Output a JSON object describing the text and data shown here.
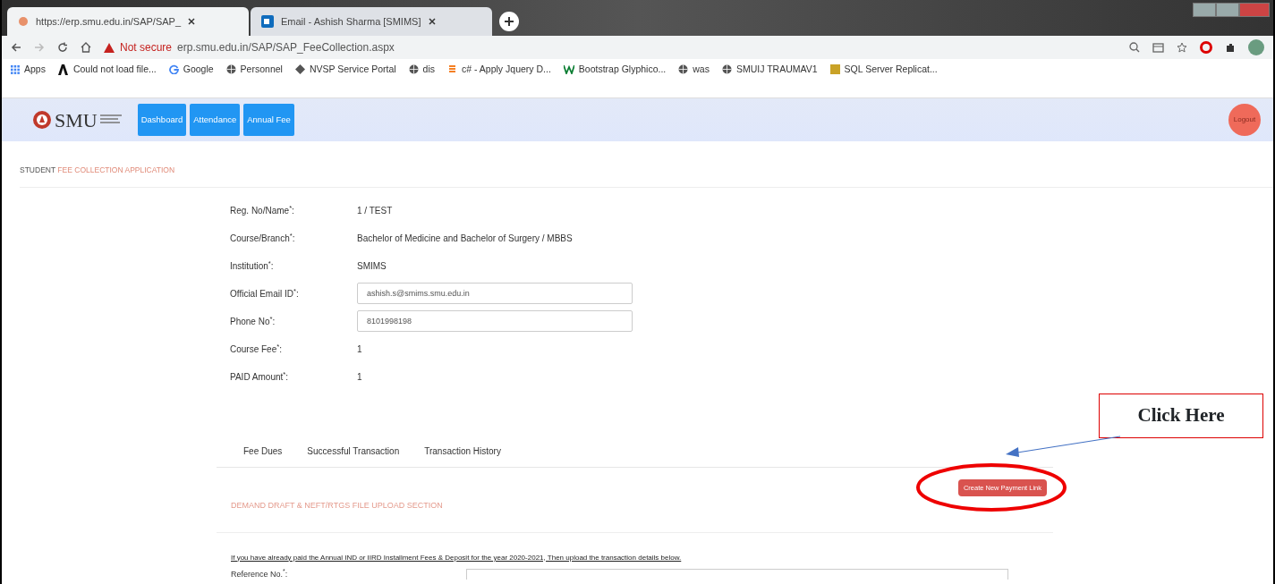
{
  "browser": {
    "tabs": [
      {
        "title": "https://erp.smu.edu.in/SAP/SAP_",
        "selected": true,
        "kind": "site"
      },
      {
        "title": "Email - Ashish Sharma [SMIMS]",
        "selected": false,
        "kind": "mail"
      }
    ],
    "address": {
      "security": "Not secure",
      "url": "erp.smu.edu.in/SAP/SAP_FeeCollection.aspx"
    },
    "bookmarks": [
      {
        "label": "Apps",
        "kind": "apps"
      },
      {
        "label": "Could not load file...",
        "kind": "ai"
      },
      {
        "label": "Google",
        "kind": "google"
      },
      {
        "label": "Personnel",
        "kind": "globe"
      },
      {
        "label": "NVSP Service Portal",
        "kind": "diamond"
      },
      {
        "label": "dis",
        "kind": "globe"
      },
      {
        "label": "c# - Apply Jquery D...",
        "kind": "stack"
      },
      {
        "label": "Bootstrap Glyphico...",
        "kind": "w"
      },
      {
        "label": "was",
        "kind": "globe"
      },
      {
        "label": "SMUIJ TRAUMAV1",
        "kind": "globe"
      },
      {
        "label": "SQL Server Replicat...",
        "kind": "sql"
      }
    ]
  },
  "app": {
    "logo": "SMU",
    "nav": [
      "Dashboard",
      "Attendance",
      "Annual Fee"
    ],
    "logout": "Logout"
  },
  "page_title": {
    "lead": "STUDENT",
    "rest": "FEE COLLECTION APPLICATION"
  },
  "fields": [
    {
      "label": "Reg. No/Name$^{*}$:",
      "value": "1 / TEST",
      "kind": "text"
    },
    {
      "label": "Course/Branch$^{*}$:",
      "value": "Bachelor of Medicine and Bachelor of Surgery / MBBS",
      "kind": "text"
    },
    {
      "label": "Institution$^{*}$:",
      "value": "SMIMS",
      "kind": "text"
    },
    {
      "label": "Official Email ID$^{*}$:",
      "value": "ashish.s@smims.smu.edu.in",
      "kind": "input"
    },
    {
      "label": "Phone No$^{*}$:",
      "value": "8101998198",
      "kind": "input"
    },
    {
      "label": "Course Fee$^{*}$:",
      "value": "1",
      "kind": "text"
    },
    {
      "label": "PAID Amount$^{*}$:",
      "value": "1",
      "kind": "text"
    }
  ],
  "tabs": [
    "Fee Dues",
    "Successful Transaction",
    "Transaction History"
  ],
  "payment_button": "Create New Payment Link",
  "section_heading": "DEMAND DRAFT & NEFT/RTGS FILE UPLOAD SECTION",
  "note": "If you have already paid the Annual IND or IIRD Installment Fees & Deposit for the year 2020-2021, Then upload the transaction details below.",
  "reference_label": "Reference No.$^{*}$:",
  "annotation": {
    "text": "Click Here"
  }
}
